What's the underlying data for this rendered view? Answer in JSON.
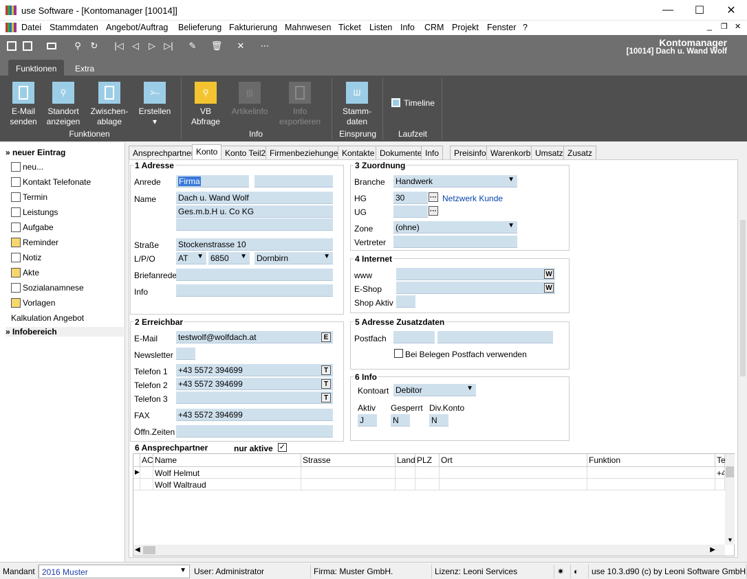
{
  "window": {
    "title": "use Software - [Kontomanager [10014]]",
    "min": "—",
    "max": "☐",
    "close": "✕",
    "child_min": "_",
    "child_restore": "❐",
    "child_close": "✕"
  },
  "menu": [
    "Datei",
    "Stammdaten",
    "Angebot/Auftrag",
    "Belieferung",
    "Fakturierung",
    "Mahnwesen",
    "Ticket",
    "Listen",
    "Info",
    "CRM",
    "Projekt",
    "Fenster",
    "?"
  ],
  "header": {
    "title": "Kontomanager",
    "subtitle": "[10014] Dach u. Wand Wolf"
  },
  "ribbon_tabs": [
    "Funktionen",
    "Extra"
  ],
  "ribbon": {
    "email": "E-Mail\nsenden",
    "standort": "Standort\nanzeigen",
    "zwischen": "Zwischen-\nablage",
    "erstellen": "Erstellen",
    "erstellen_arrow": "▾",
    "vb": "VB\nAbfrage",
    "artikel": "Artikelinfo",
    "infoexp": "Info\nexportieren",
    "stamm": "Stamm-\ndaten",
    "timeline": "Timeline",
    "groups": {
      "funktionen": "Funktionen",
      "info": "Info",
      "einsprung": "Einsprung",
      "laufzeit": "Laufzeit"
    }
  },
  "sidebar": {
    "head1": "neuer Eintrag",
    "items": [
      "neu...",
      "Kontakt Telefonate",
      "Termin",
      "Leistungs",
      "Aufgabe",
      "Reminder",
      "Notiz",
      "Akte",
      "Sozialanamnese",
      "Vorlagen",
      "Kalkulation Angebot"
    ],
    "head2": "Infobereich",
    "chev": "»"
  },
  "tabs": [
    "Ansprechpartner",
    "Konto",
    "Konto Teil2",
    "Firmenbeziehungen",
    "Kontakte",
    "Dokumente",
    "Info",
    "Preisinfo",
    "Warenkorb",
    "Umsatz",
    "Zusatz"
  ],
  "adresse": {
    "title": "1 Adresse",
    "anrede_l": "Anrede",
    "anrede": "Firma",
    "name_l": "Name",
    "name1": "Dach u. Wand Wolf",
    "name2": "Ges.m.b.H u. Co KG",
    "strasse_l": "Straße",
    "strasse": "Stockenstrasse 10",
    "lpo_l": "L/P/O",
    "land": "AT",
    "plz": "6850",
    "ort": "Dornbirn",
    "brief_l": "Briefanrede",
    "info_l": "Info"
  },
  "zuordnung": {
    "title": "3 Zuordnung",
    "branche_l": "Branche",
    "branche": "Handwerk",
    "hg_l": "HG",
    "hg": "30",
    "hg_link": "Netzwerk Kunde",
    "ug_l": "UG",
    "zone_l": "Zone",
    "zone": "(ohne)",
    "vertreter_l": "Vertreter",
    "dots": "···"
  },
  "internet": {
    "title": "4 Internet",
    "www_l": "www",
    "shop_l": "E-Shop",
    "aktiv_l": "Shop Aktiv",
    "w": "W"
  },
  "erreichbar": {
    "title": "2 Erreichbar",
    "email_l": "E-Mail",
    "email": "testwolf@wolfdach.at",
    "news_l": "Newsletter",
    "t1_l": "Telefon 1",
    "t1": "+43 5572 394699",
    "t2_l": "Telefon 2",
    "t2": "+43 5572 394699",
    "t3_l": "Telefon 3",
    "fax_l": "FAX",
    "fax": "+43 5572 394699",
    "oeff_l": "Öffn.Zeiten",
    "e": "E",
    "t": "T"
  },
  "zusatz": {
    "title": "5 Adresse Zusatzdaten",
    "postfach_l": "Postfach",
    "chk": "Bei Belegen Postfach verwenden"
  },
  "info": {
    "title": "6 Info",
    "kontoart_l": "Kontoart",
    "kontoart": "Debitor",
    "aktiv_l": "Aktiv",
    "aktiv": "J",
    "gesperrt_l": "Gesperrt",
    "gesperrt": "N",
    "div_l": "Div.Konto",
    "div": "N"
  },
  "ansprech": {
    "title": "6 Ansprechpartner",
    "nur_l": "nur aktive",
    "check": "✓",
    "cols": [
      "AC",
      "Name",
      "Strasse",
      "Land",
      "PLZ",
      "Ort",
      "Funktion",
      "Te"
    ],
    "rows": [
      [
        "Wolf Helmut",
        "+4"
      ],
      [
        "Wolf Waltraud",
        ""
      ]
    ],
    "marker": "▶"
  },
  "status": {
    "mandant_l": "Mandant",
    "mandant": "2016 Muster",
    "user": "User: Administrator",
    "firma": "Firma: Muster GmbH.",
    "lizenz": "Lizenz: Leoni Services",
    "version": "use 10.3.d90 (c) by Leoni Software GmbH"
  },
  "colors": {
    "dark": "#4f4f4f",
    "toolbar": "#6f6f6f",
    "field": "#cfe0ed",
    "accent": "#9ccde6"
  }
}
